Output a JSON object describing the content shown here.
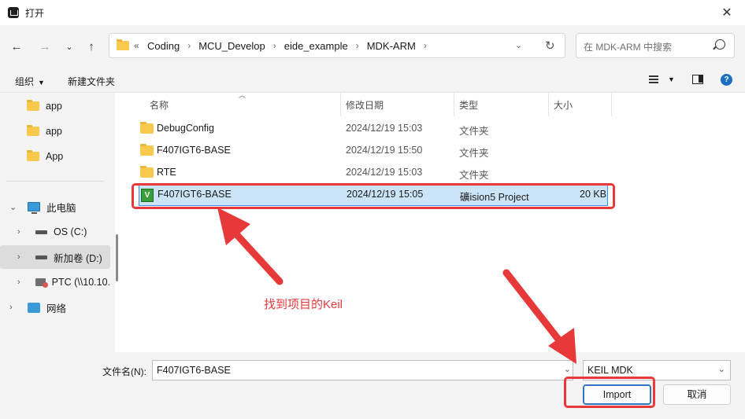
{
  "window": {
    "title": "打开"
  },
  "address": {
    "more": "«",
    "crumbs": [
      "Coding",
      "MCU_Develop",
      "eide_example",
      "MDK-ARM"
    ],
    "search_placeholder": "在 MDK-ARM 中搜索"
  },
  "commands": {
    "organize": "组织",
    "new_folder": "新建文件夹"
  },
  "sidebar": {
    "items": [
      {
        "label": "app",
        "icon": "folder-icon"
      },
      {
        "label": "app",
        "icon": "folder-icon"
      },
      {
        "label": "App",
        "icon": "folder-icon"
      },
      {
        "label": "此电脑",
        "icon": "pc-icon",
        "expanded": true
      },
      {
        "label": "OS (C:)",
        "icon": "drive-icon"
      },
      {
        "label": "新加卷 (D:)",
        "icon": "drive-icon",
        "selected": true
      },
      {
        "label": "PTC (\\\\10.10.",
        "icon": "network-drive-icon"
      },
      {
        "label": "网络",
        "icon": "network-icon"
      }
    ]
  },
  "columns": {
    "name": "名称",
    "modified": "修改日期",
    "type": "类型",
    "size": "大小"
  },
  "files": [
    {
      "name": "DebugConfig",
      "modified": "2024/12/19 15:03",
      "type": "文件夹",
      "size": "",
      "icon": "folder-icon"
    },
    {
      "name": "F407IGT6-BASE",
      "modified": "2024/12/19 15:50",
      "type": "文件夹",
      "size": "",
      "icon": "folder-icon"
    },
    {
      "name": "RTE",
      "modified": "2024/12/19 15:03",
      "type": "文件夹",
      "size": "",
      "icon": "folder-icon"
    },
    {
      "name": "F407IGT6-BASE",
      "modified": "2024/12/19 15:05",
      "type": "礦ision5 Project",
      "size": "20 KB",
      "icon": "keil-project-icon",
      "selected": true
    }
  ],
  "footer": {
    "filename_label": "文件名(N):",
    "filename_value": "F407IGT6-BASE",
    "filetype_value": "KEIL MDK",
    "import_label": "Import",
    "cancel_label": "取消"
  },
  "annotation": {
    "text": "找到项目的Keil",
    "color": "#e8393a"
  }
}
